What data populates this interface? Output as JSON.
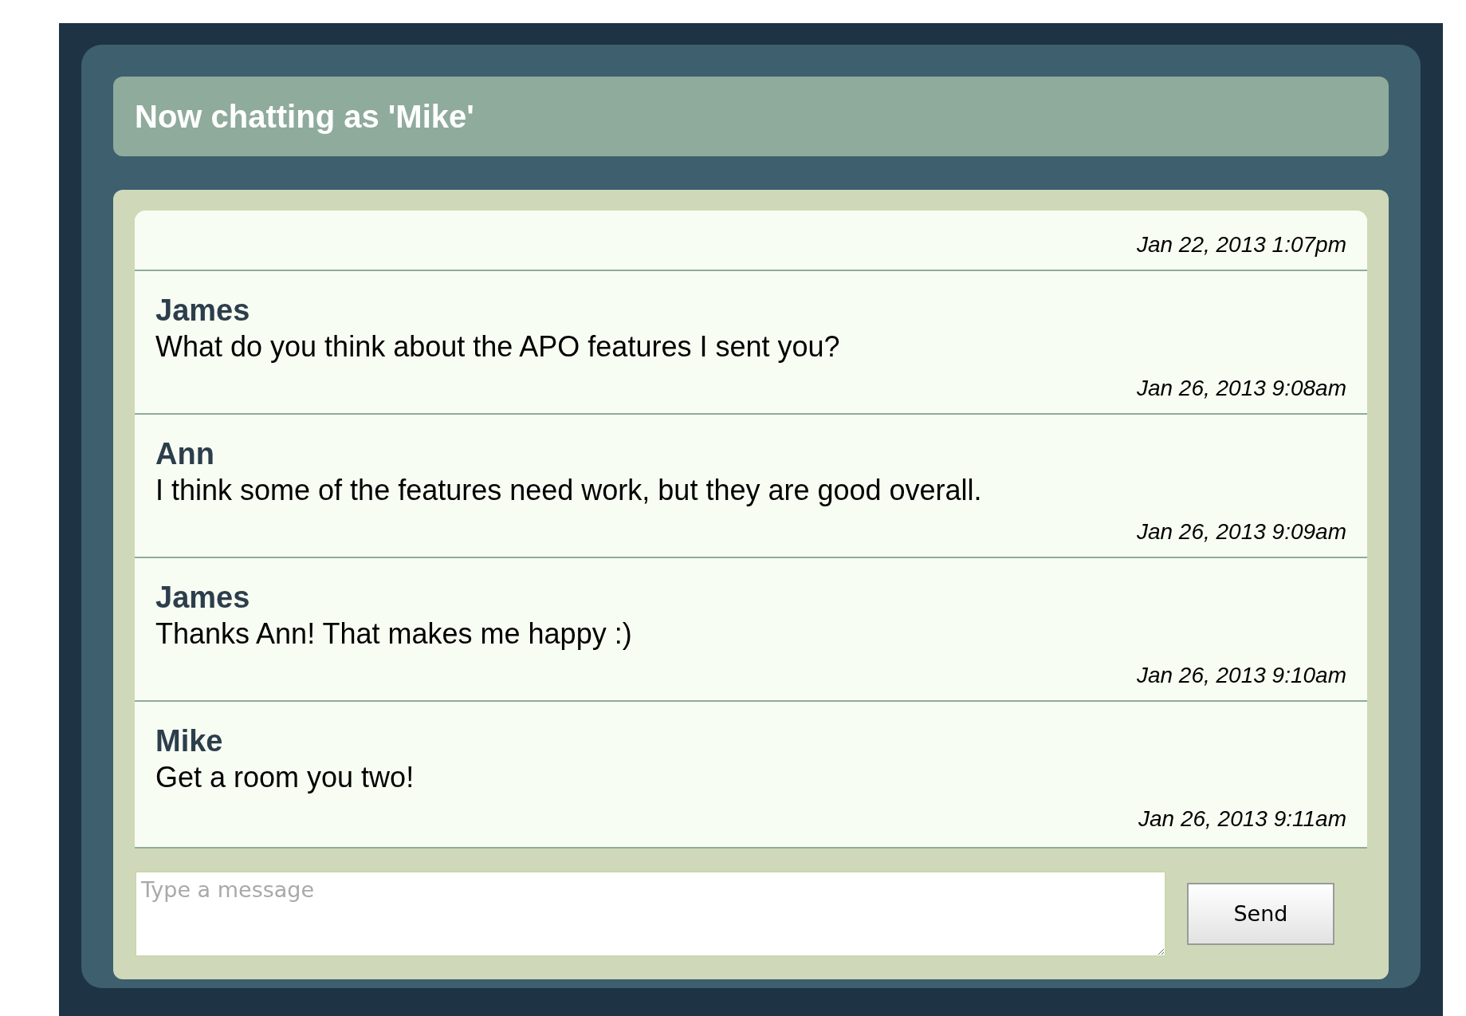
{
  "header": {
    "title": "Now chatting as 'Mike'"
  },
  "messages": [
    {
      "time": "Jan 22, 2013 1:07pm"
    },
    {
      "author": "James",
      "text": "What do you think about the APO features I sent you?",
      "time": "Jan 26, 2013 9:08am"
    },
    {
      "author": "Ann",
      "text": "I think some of the features need work, but they are good overall.",
      "time": "Jan 26, 2013 9:09am"
    },
    {
      "author": "James",
      "text": "Thanks Ann! That makes me happy :)",
      "time": "Jan 26, 2013 9:10am"
    },
    {
      "author": "Mike",
      "text": "Get a room you two!",
      "time": "Jan 26, 2013 9:11am"
    }
  ],
  "composer": {
    "placeholder": "Type a message",
    "button": "Send"
  }
}
